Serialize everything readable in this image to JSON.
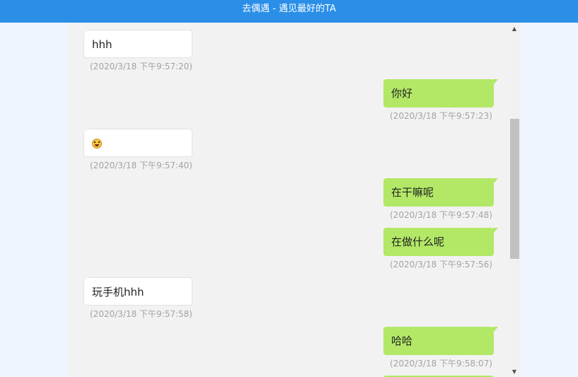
{
  "header": {
    "title": "去偶遇 - 遇见最好的TA"
  },
  "messages": [
    {
      "direction": "in",
      "text": "hhh",
      "time": "(2020/3/18 下午9:57:20)"
    },
    {
      "direction": "out",
      "text": "你好",
      "time": "(2020/3/18 下午9:57:23)"
    },
    {
      "direction": "in",
      "emoji": "grinning-face-emoji",
      "time": "(2020/3/18 下午9:57:40)"
    },
    {
      "direction": "out",
      "text": "在干嘛呢",
      "time": "(2020/3/18 下午9:57:48)"
    },
    {
      "direction": "out",
      "text": "在做什么呢",
      "time": "(2020/3/18 下午9:57:56)"
    },
    {
      "direction": "in",
      "text": "玩手机hhh",
      "time": "(2020/3/18 下午9:57:58)"
    },
    {
      "direction": "out",
      "text": "哈哈",
      "time": "(2020/3/18 下午9:58:07)"
    }
  ],
  "colors": {
    "header": "#2b8fe8",
    "outgoing_bubble": "#b2e866",
    "incoming_bubble": "#ffffff",
    "chat_background": "#f2f2f2",
    "timestamp": "#a3a3a3"
  }
}
